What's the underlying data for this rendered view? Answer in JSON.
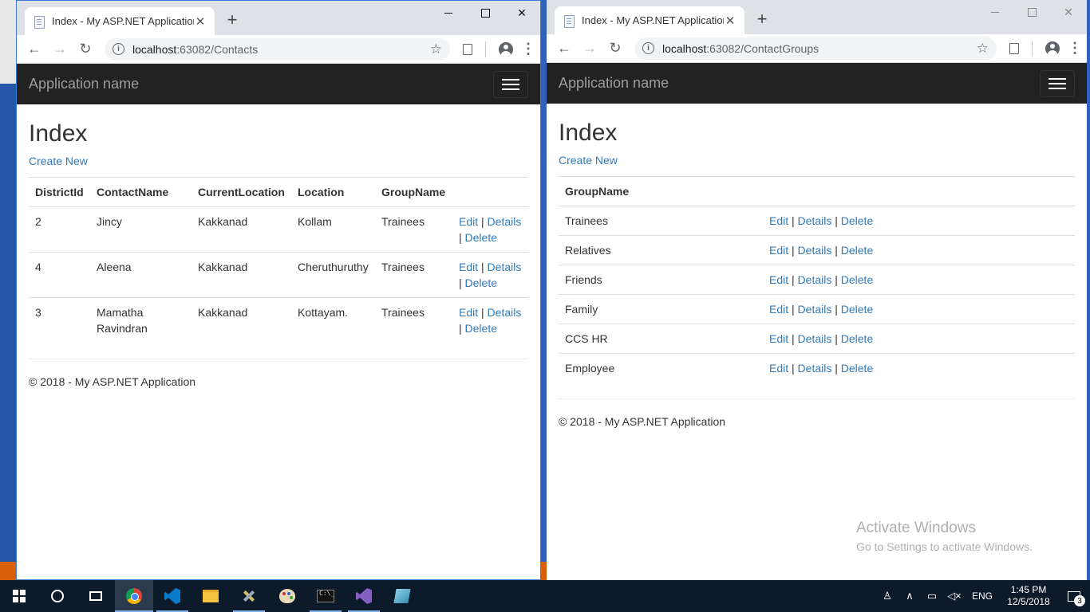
{
  "left_window": {
    "tab_title": "Index - My ASP.NET Application",
    "url_host": "localhost",
    "url_path": ":63082/Contacts",
    "brand": "Application name",
    "heading": "Index",
    "create_link": "Create New",
    "columns": [
      "DistrictId",
      "ContactName",
      "CurrentLocation",
      "Location",
      "GroupName"
    ],
    "rows": [
      {
        "district_id": "2",
        "contact_name": "Jincy",
        "current_location": "Kakkanad",
        "location": "Kollam",
        "group_name": "Trainees"
      },
      {
        "district_id": "4",
        "contact_name": "Aleena",
        "current_location": "Kakkanad",
        "location": "Cheruthuruthy",
        "group_name": "Trainees"
      },
      {
        "district_id": "3",
        "contact_name": "Mamatha Ravindran",
        "current_location": "Kakkanad",
        "location": "Kottayam.",
        "group_name": "Trainees"
      }
    ],
    "footer": "© 2018 - My ASP.NET Application"
  },
  "right_window": {
    "tab_title": "Index - My ASP.NET Application",
    "url_host": "localhost",
    "url_path": ":63082/ContactGroups",
    "brand": "Application name",
    "heading": "Index",
    "create_link": "Create New",
    "column": "GroupName",
    "rows": [
      "Trainees",
      "Relatives",
      "Friends",
      "Family",
      "CCS HR",
      "Employee"
    ],
    "footer": "© 2018 - My ASP.NET Application"
  },
  "actions": {
    "edit": "Edit",
    "details": "Details",
    "delete": "Delete",
    "separator": "|"
  },
  "watermark": {
    "title": "Activate Windows",
    "subtitle": "Go to Settings to activate Windows."
  },
  "taskbar": {
    "language": "ENG",
    "time": "1:45 PM",
    "date": "12/5/2018",
    "notification_count": "3",
    "apps": [
      "start-icon",
      "cortana-icon",
      "task-view-icon",
      "chrome-icon",
      "vscode-icon",
      "file-explorer-icon",
      "tools-icon",
      "paint-icon",
      "cmd-icon",
      "visual-studio-icon",
      "app-icon"
    ]
  }
}
